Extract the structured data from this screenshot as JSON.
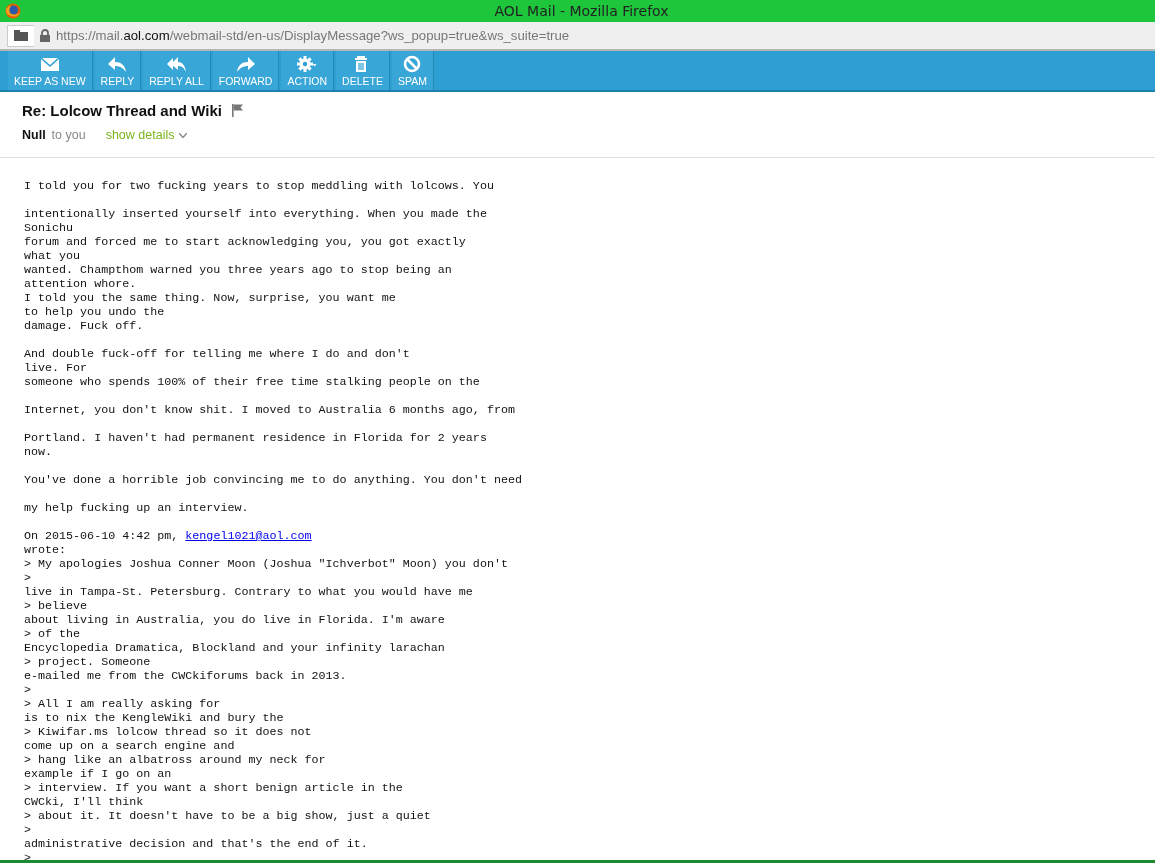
{
  "window": {
    "title": "AOL Mail - Mozilla Firefox"
  },
  "address_bar": {
    "url": "https://mail.**aol.com**/webmail-std/en-us/DisplayMessage?ws_popup=true&ws_suite=true"
  },
  "toolbar": [
    {
      "label": "KEEP AS NEW",
      "kind": "envelope"
    },
    {
      "label": "REPLY",
      "kind": "reply"
    },
    {
      "label": "REPLY ALL",
      "kind": "replyall"
    },
    {
      "label": "FORWARD",
      "kind": "forward"
    },
    {
      "label": "ACTION",
      "kind": "gear"
    },
    {
      "label": "DELETE",
      "kind": "trash"
    },
    {
      "label": "SPAM",
      "kind": "block"
    }
  ],
  "message": {
    "subject": "Re: Lolcow Thread and Wiki",
    "flagged": false,
    "sender": "Null",
    "recipient": "to you",
    "details_link": "show details",
    "lines": [
      {
        "kind": "text",
        "text": "I told you for two fucking years to stop meddling with lolcows. You"
      },
      {
        "kind": "blank"
      },
      {
        "kind": "text",
        "text": "intentionally inserted yourself into everything. When you made the"
      },
      {
        "kind": "text",
        "text": "Sonichu"
      },
      {
        "kind": "text",
        "text": "forum and forced me to start acknowledging you, you got exactly"
      },
      {
        "kind": "text",
        "text": "what you"
      },
      {
        "kind": "text",
        "text": "wanted. Champthom warned you three years ago to stop being an"
      },
      {
        "kind": "text",
        "text": "attention whore."
      },
      {
        "kind": "text",
        "text": "I told you the same thing. Now, surprise, you want me"
      },
      {
        "kind": "text",
        "text": "to help you undo the"
      },
      {
        "kind": "text",
        "text": "damage. Fuck off."
      },
      {
        "kind": "blank"
      },
      {
        "kind": "text",
        "text": "And double fuck-off for telling me where I do and don't"
      },
      {
        "kind": "text",
        "text": "live. For"
      },
      {
        "kind": "text",
        "text": "someone who spends 100% of their free time stalking people on the"
      },
      {
        "kind": "blank"
      },
      {
        "kind": "text",
        "text": "Internet, you don't know shit. I moved to Australia 6 months ago, from"
      },
      {
        "kind": "blank"
      },
      {
        "kind": "text",
        "text": "Portland. I haven't had permanent residence in Florida for 2 years"
      },
      {
        "kind": "text",
        "text": "now."
      },
      {
        "kind": "blank"
      },
      {
        "kind": "text",
        "text": "You've done a horrible job convincing me to do anything. You don't need"
      },
      {
        "kind": "blank"
      },
      {
        "kind": "text",
        "text": "my help fucking up an interview."
      },
      {
        "kind": "blank"
      },
      {
        "kind": "link",
        "text": "On 2015-06-10 4:42 pm, ",
        "link": "kengel1021@aol.com"
      },
      {
        "kind": "text",
        "text": "wrote:"
      },
      {
        "kind": "text",
        "text": "> My apologies Joshua Conner Moon (Joshua \"Ichverbot\" Moon) you don't"
      },
      {
        "kind": "text",
        "text": ">"
      },
      {
        "kind": "text",
        "text": "live in Tampa-St. Petersburg. Contrary to what you would have me"
      },
      {
        "kind": "text",
        "text": "> believe"
      },
      {
        "kind": "text",
        "text": "about living in Australia, you do live in Florida. I'm aware"
      },
      {
        "kind": "text",
        "text": "> of the"
      },
      {
        "kind": "text",
        "text": "Encyclopedia Dramatica, Blockland and your infinity larachan"
      },
      {
        "kind": "text",
        "text": "> project. Someone"
      },
      {
        "kind": "text",
        "text": "e-mailed me from the CWCkiforums back in 2013."
      },
      {
        "kind": "text",
        "text": ">"
      },
      {
        "kind": "text",
        "text": "> All I am really asking for"
      },
      {
        "kind": "text",
        "text": "is to nix the KengleWiki and bury the"
      },
      {
        "kind": "text",
        "text": "> Kiwifar.ms lolcow thread so it does not"
      },
      {
        "kind": "text",
        "text": "come up on a search engine and"
      },
      {
        "kind": "text",
        "text": "> hang like an albatross around my neck for"
      },
      {
        "kind": "text",
        "text": "example if I go on an"
      },
      {
        "kind": "text",
        "text": "> interview. If you want a short benign article in the"
      },
      {
        "kind": "text",
        "text": "CWCki, I'll think"
      },
      {
        "kind": "text",
        "text": "> about it. It doesn't have to be a big show, just a quiet"
      },
      {
        "kind": "text",
        "text": ">"
      },
      {
        "kind": "text",
        "text": "administrative decision and that's the end of it."
      },
      {
        "kind": "text",
        "text": ">"
      }
    ]
  }
}
